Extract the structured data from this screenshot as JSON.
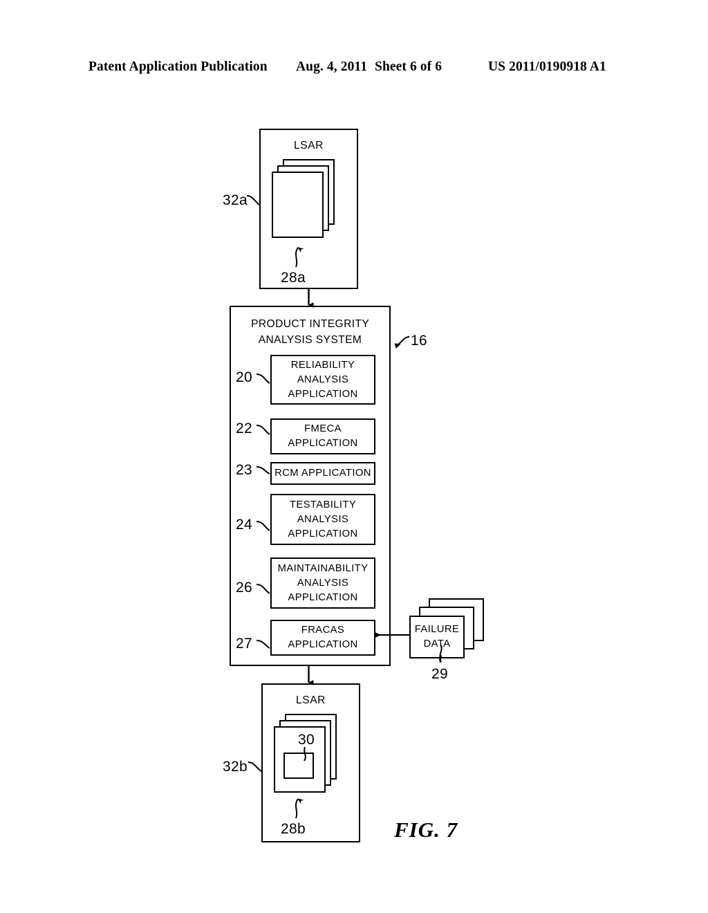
{
  "header": {
    "title": "Patent Application Publication",
    "date": "Aug. 4, 2011",
    "sheet": "Sheet 6 of 6",
    "number": "US 2011/0190918 A1"
  },
  "figure": {
    "caption": "FIG. 7",
    "line_color": "#000000",
    "background": "#ffffff"
  },
  "top_lsar": {
    "title": "LSAR",
    "container_ref": "32a",
    "sheet_ref": "28a",
    "sheet_count": 3
  },
  "system": {
    "title_line1": "PRODUCT INTEGRITY",
    "title_line2": "ANALYSIS SYSTEM",
    "ref": "16",
    "applications": [
      {
        "ref": "20",
        "lines": [
          "RELIABILITY",
          "ANALYSIS",
          "APPLICATION"
        ]
      },
      {
        "ref": "22",
        "lines": [
          "FMECA",
          "APPLICATION"
        ]
      },
      {
        "ref": "23",
        "lines": [
          "RCM APPLICATION"
        ]
      },
      {
        "ref": "24",
        "lines": [
          "TESTABILITY",
          "ANALYSIS",
          "APPLICATION"
        ]
      },
      {
        "ref": "26",
        "lines": [
          "MAINTAINABILITY",
          "ANALYSIS",
          "APPLICATION"
        ]
      },
      {
        "ref": "27",
        "lines": [
          "FRACAS",
          "APPLICATION"
        ]
      }
    ]
  },
  "failure_data": {
    "line1": "FAILURE",
    "line2": "DATA",
    "ref": "29",
    "sheet_count": 3
  },
  "bottom_lsar": {
    "title": "LSAR",
    "container_ref": "32b",
    "sheet_ref": "28b",
    "inner_ref": "30",
    "sheet_count": 3
  }
}
